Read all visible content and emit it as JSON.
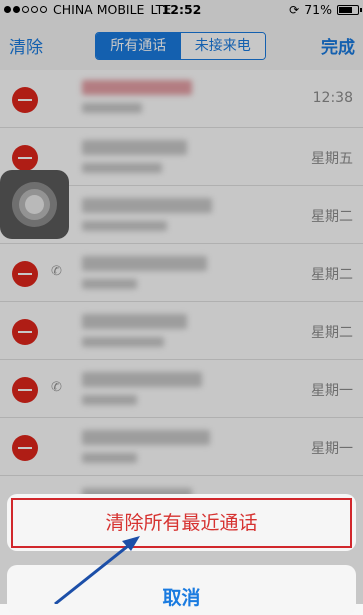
{
  "status_bar": {
    "carrier": "CHINA MOBILE",
    "network": "LTE",
    "time": "12:52",
    "battery_percent_label": "71%",
    "battery_level": 0.71
  },
  "nav": {
    "left_label": "清除",
    "segments": [
      "所有通话",
      "未接来电"
    ],
    "selected_segment": "所有通话",
    "right_label": "完成"
  },
  "calls": [
    {
      "time": "12:38",
      "has_phone_icon": false,
      "missed": true
    },
    {
      "time": "星期五",
      "has_phone_icon": false,
      "missed": false
    },
    {
      "time": "星期二",
      "has_phone_icon": true,
      "missed": false
    },
    {
      "time": "星期二",
      "has_phone_icon": true,
      "missed": false
    },
    {
      "time": "星期二",
      "has_phone_icon": false,
      "missed": false
    },
    {
      "time": "星期一",
      "has_phone_icon": true,
      "missed": false
    },
    {
      "time": "星期一",
      "has_phone_icon": false,
      "missed": false
    },
    {
      "time": "",
      "has_phone_icon": false,
      "missed": false
    }
  ],
  "action_sheet": {
    "destructive_label": "清除所有最近通话",
    "cancel_label": "取消"
  },
  "colors": {
    "ios_blue": "#1a7be0",
    "delete_red": "#e0261c",
    "highlight_red": "#d1272c",
    "arrow_blue": "#1c4fa8"
  }
}
